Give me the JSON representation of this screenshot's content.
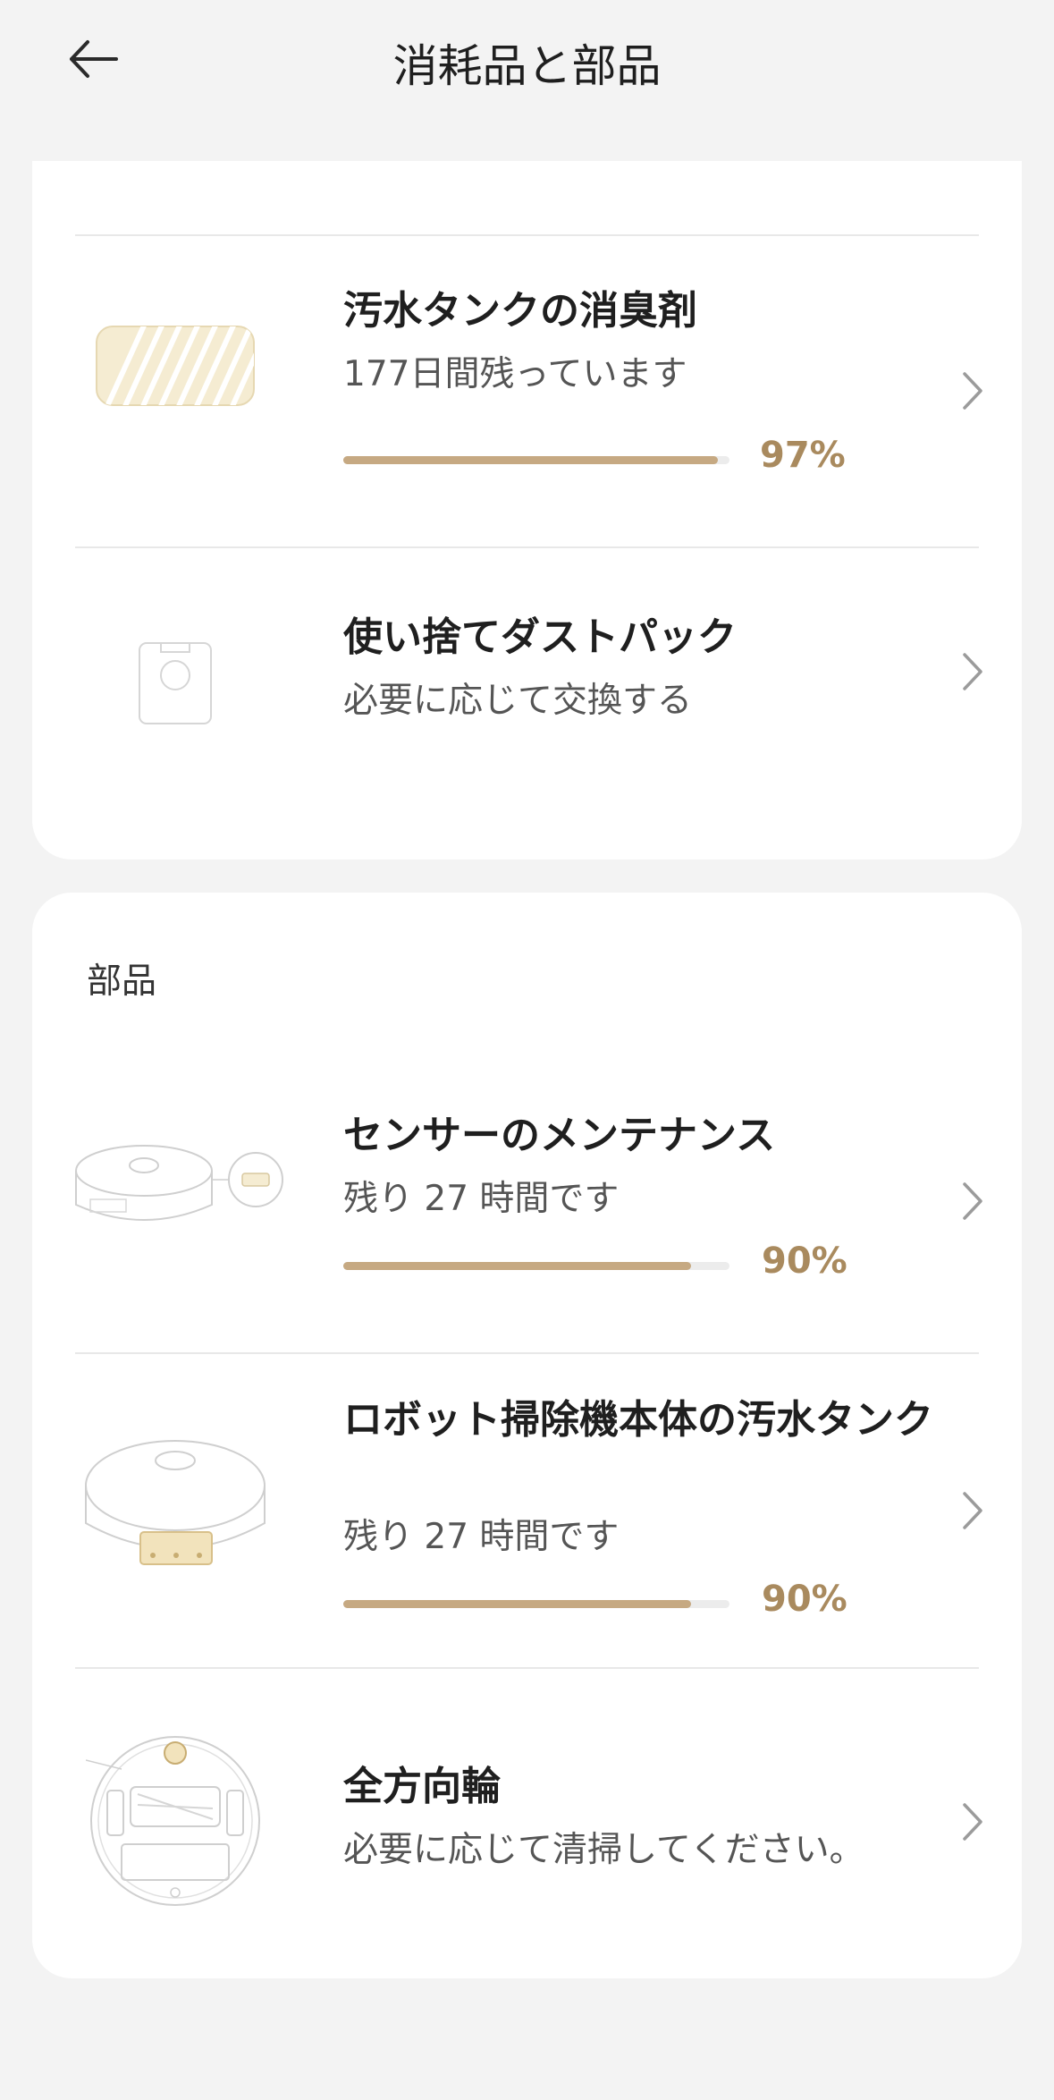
{
  "header": {
    "title": "消耗品と部品",
    "back_icon": "arrow-left-icon"
  },
  "consumables": [
    {
      "title": "汚水タンクの消臭剤",
      "subtitle": "177日間残っています",
      "percent_label": "97%",
      "progress": 0.97,
      "icon": "deodorizer-image"
    },
    {
      "title": "使い捨てダストパック",
      "subtitle": "必要に応じて交換する",
      "icon": "dust-bag-image"
    }
  ],
  "parts_section": {
    "label": "部品",
    "items": [
      {
        "title": "センサーのメンテナンス",
        "subtitle": "残り 27 時間です",
        "percent_label": "90%",
        "progress": 0.9,
        "icon": "robot-sensor-image"
      },
      {
        "title": "ロボット掃除機本体の汚水タンク",
        "subtitle": "残り 27 時間です",
        "percent_label": "90%",
        "progress": 0.9,
        "icon": "robot-tank-image"
      },
      {
        "title": "全方向輪",
        "subtitle": "必要に応じて清掃してください。",
        "icon": "robot-wheel-image"
      }
    ]
  },
  "colors": {
    "accent": "#c6a982",
    "percent_text": "#a98a5e",
    "background": "#f3f3f3",
    "card": "#ffffff"
  }
}
